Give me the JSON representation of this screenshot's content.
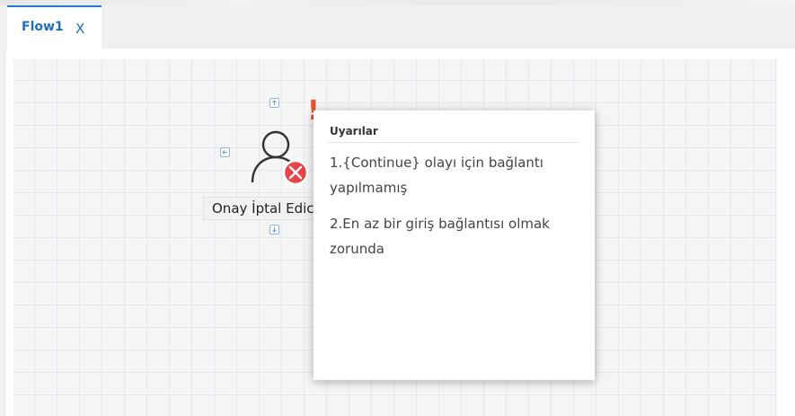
{
  "tab": {
    "title": "Flow1",
    "close_label": "X"
  },
  "node": {
    "label": "Onay İptal Edici",
    "warning_mark": "!",
    "status": "error"
  },
  "popup": {
    "title": "Uyarılar",
    "messages": [
      "1.{Continue} olayı için bağlantı yapılmamış",
      "2.En az bir giriş bağlantısı olmak zorunda"
    ]
  },
  "colors": {
    "accent": "#1e6fbd",
    "warning": "#e8532c",
    "error": "#e8434a",
    "port_border": "#8fb4d9"
  }
}
